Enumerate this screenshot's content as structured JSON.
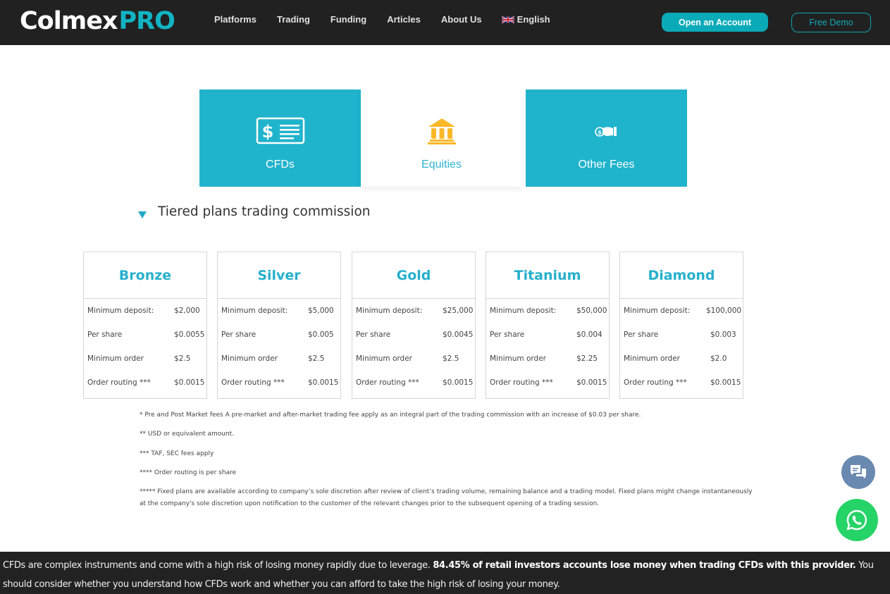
{
  "header": {
    "logo": {
      "brand": "Colmex",
      "suffix": "PRO"
    },
    "nav": [
      {
        "label": "Platforms"
      },
      {
        "label": "Trading"
      },
      {
        "label": "Funding"
      },
      {
        "label": "Articles"
      },
      {
        "label": "About Us"
      }
    ],
    "language": {
      "label": "English",
      "flag_icon": "uk-flag-icon"
    },
    "open_account_label": "Open an Account",
    "free_demo_label": "Free Demo"
  },
  "categories": [
    {
      "label": "CFDs",
      "icon": "dollar-document-icon",
      "active": false
    },
    {
      "label": "Equities",
      "icon": "bank-building-icon",
      "active": true
    },
    {
      "label": "Other Fees",
      "icon": "hand-coin-icon",
      "active": false
    }
  ],
  "section": {
    "title": "Tiered plans trading commission",
    "toggle_icon": "triangle-down-icon"
  },
  "plans": [
    {
      "name": "Bronze",
      "rows": [
        {
          "label": "Minimum deposit:",
          "value": "$2,000"
        },
        {
          "label": "Per share",
          "value": "$0.0055"
        },
        {
          "label": "Minimum order",
          "value": "$2.5"
        },
        {
          "label": "Order routing ***",
          "value": "$0.0015"
        }
      ]
    },
    {
      "name": "Silver",
      "rows": [
        {
          "label": "Minimum deposit:",
          "value": "$5,000"
        },
        {
          "label": "Per share",
          "value": "$0.005"
        },
        {
          "label": "Minimum order",
          "value": "$2.5"
        },
        {
          "label": "Order routing ***",
          "value": "$0.0015"
        }
      ]
    },
    {
      "name": "Gold",
      "rows": [
        {
          "label": "Minimum deposit:",
          "value": "$25,000"
        },
        {
          "label": "Per share",
          "value": "$0.0045"
        },
        {
          "label": "Minimum order",
          "value": "$2.5"
        },
        {
          "label": "Order routing ***",
          "value": "$0.0015"
        }
      ]
    },
    {
      "name": "Titanium",
      "rows": [
        {
          "label": "Minimum deposit:",
          "value": "$50,000"
        },
        {
          "label": "Per share",
          "value": "$0.004"
        },
        {
          "label": "Minimum order",
          "value": "$2.25"
        },
        {
          "label": "Order routing ***",
          "value": "$0.0015"
        }
      ]
    },
    {
      "name": "Diamond",
      "rows": [
        {
          "label": "Minimum deposit:",
          "value": "$100,000"
        },
        {
          "label": "Per share",
          "value": "$0.003"
        },
        {
          "label": "Minimum order",
          "value": "$2.0"
        },
        {
          "label": "Order routing ***",
          "value": "$0.0015"
        }
      ]
    }
  ],
  "footnotes": [
    "* Pre and Post Market fees A pre-market and after-market trading fee apply as an integral part of the trading commission with an increase of $0.03 per share.",
    "** USD or equivalent amount.",
    "*** TAF, SEC fees apply",
    "**** Order routing is per share",
    "***** Fixed plans are available according to company’s sole discretion after review of client’s trading volume, remaining balance and a trading model. Fixed plans might change instantaneously at the company's sole discretion upon notification to the customer of the relevant changes prior to the subsequent opening of a trading session."
  ],
  "floating": {
    "chat_icon": "chat-bubbles-icon",
    "whatsapp_icon": "whatsapp-icon"
  },
  "risk_warning": {
    "text_before": "CFDs are complex instruments and come with a high risk of losing money rapidly due to leverage. ",
    "bold": "84.45% of retail investors accounts lose money when trading CFDs with this provider.",
    "text_after": " You should consider whether you understand how CFDs work and whether you can afford to take the high risk of losing your money."
  },
  "colors": {
    "accent": "#20b3cc",
    "header_bg": "#212121",
    "button_teal": "#0baab8",
    "icon_gold": "#fbb829",
    "whatsapp_green": "#25d366",
    "chat_blue": "#6a89b1"
  }
}
